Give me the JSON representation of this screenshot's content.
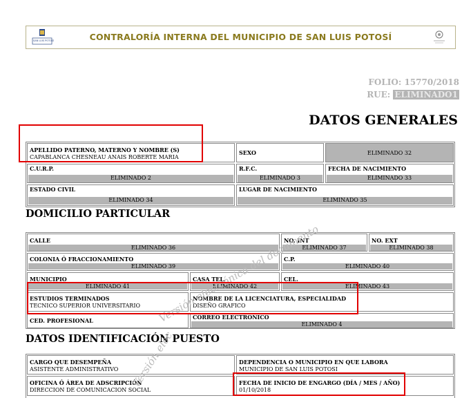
{
  "header": {
    "title": "CONTRALORÍA INTERNA DEL MUNICIPIO DE SAN LUIS POTOSÍ",
    "logo_left_caption": "SAN LUIS POTOSÍ"
  },
  "folio_line": "FOLIO: 15770/2018",
  "rue_label": "RUE:",
  "rue_value": "ELIMINADO1",
  "datos_generales": {
    "heading": "DATOS GENERALES",
    "apellido_label": "APELLIDO PATERNO, MATERNO Y NOMBRE (S)",
    "apellido_value": "CAPABLANCA CHESNEAU ANAIS ROBERTE MARIA",
    "sexo_label": "SEXO",
    "sexo_value": "ELIMINADO 32",
    "curp_label": "C.U.R.P.",
    "curp_value": "ELIMINADO 2",
    "rfc_label": "R.F.C.",
    "rfc_value": "ELIMINADO 3",
    "nacimiento_label": "FECHA DE NACIMIENTO",
    "nacimiento_value": "ELIMINADO 33",
    "civil_label": "ESTADO CIVIL",
    "civil_value": "ELIMINADO 34",
    "lugar_label": "LUGAR DE NACIMIENTO",
    "lugar_value": "ELIMINADO 35"
  },
  "domicilio": {
    "heading": "DOMICILIO PARTICULAR",
    "calle_label": "CALLE",
    "calle_value": "ELIMINADO 36",
    "noint_label": "NO. INT",
    "noint_value": "ELIMINADO 37",
    "noext_label": "NO. EXT",
    "noext_value": "ELIMINADO 38",
    "colonia_label": "COLONIA Ó FRACCIONAMIENTO",
    "colonia_value": "ELIMINADO 39",
    "cp_label": "C.P.",
    "cp_value": "ELIMINADO 40",
    "municipio_label": "MUNICIPIO",
    "municipio_value": "ELIMINADO 41",
    "casatel_label": "CASA TEL.",
    "casatel_value": "ELIMINADO 42",
    "cel_label": "CEL.",
    "cel_value": "ELIMINADO 43",
    "estudios_label": "ESTUDIOS TERMINADOS",
    "estudios_value": "TECNICO SUPERIOR UNIVERSITARIO",
    "licenciatura_label": "NOMBRE DE LA LICENCIATURA, ESPECIALIDAD",
    "licenciatura_value": "DISEÑO GRAFICO",
    "cedula_label": "CED. PROFESIONAL",
    "correo_label": "CORREO ELECTRONICO",
    "correo_value": "ELIMINADO 4"
  },
  "puesto": {
    "heading": "DATOS IDENTIFICACIÓN PUESTO",
    "cargo_label": "CARGO QUE DESEMPEÑA",
    "cargo_value": "ASISTENTE ADMINISTRATIVO",
    "dependencia_label": "DEPENDENCIA O MUNICIPIO EN QUE LABORA",
    "dependencia_value": "MUNICIPIO DE SAN LUIS POTOSI",
    "oficina_label": "OFICINA Ó ÁREA DE ADSCRIPCIÓN",
    "oficina_value": "DIRECCION DE COMUNICACION SOCIAL",
    "fecha_label": "FECHA DE INICIO DE ENGARGO (DÍA / MES / AÑO)",
    "fecha_value": "01/10/2018"
  },
  "watermark": {
    "line1": "Versión electrónica del documento",
    "line2": "Versión elec"
  },
  "colors": {
    "banner_text": "#8a7a1e",
    "redacted_bar": "#b4b4b4",
    "highlight_box": "#e10000"
  }
}
